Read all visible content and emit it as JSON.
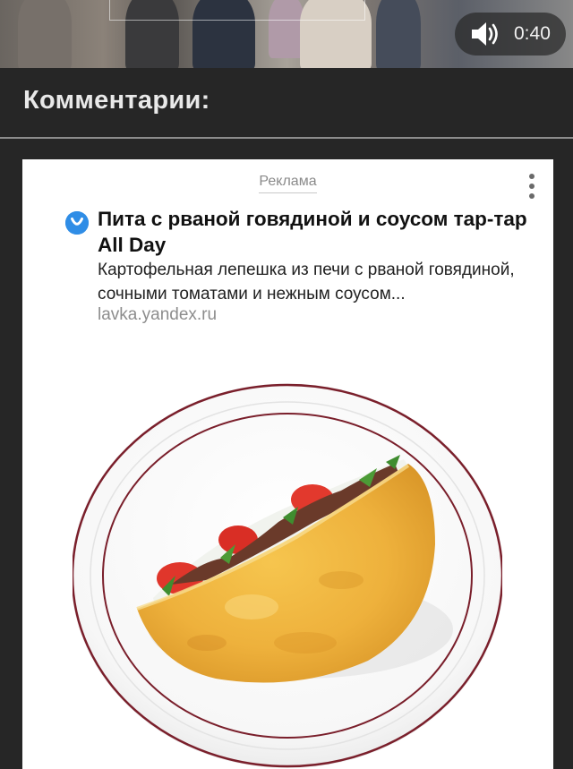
{
  "video": {
    "time": "0:40",
    "volume_icon": "speaker-icon"
  },
  "comments": {
    "title": "Комментарии:"
  },
  "ad": {
    "label": "Реклама",
    "more_icon": "more-vertical-icon",
    "brand_icon": "yandex-lavka-badge-icon",
    "title": "Пита с рваной говядиной и соусом тар-тар All Day",
    "description": "Картофельная лепешка из печи с рваной говядиной, сочными томатами и нежным соусом...",
    "domain": "lavka.yandex.ru",
    "image": "pita-on-plate-image"
  },
  "colors": {
    "background": "#262626",
    "card": "#ffffff",
    "brand_blue": "#2f8de6",
    "plate_rim": "#7a1f2b"
  }
}
